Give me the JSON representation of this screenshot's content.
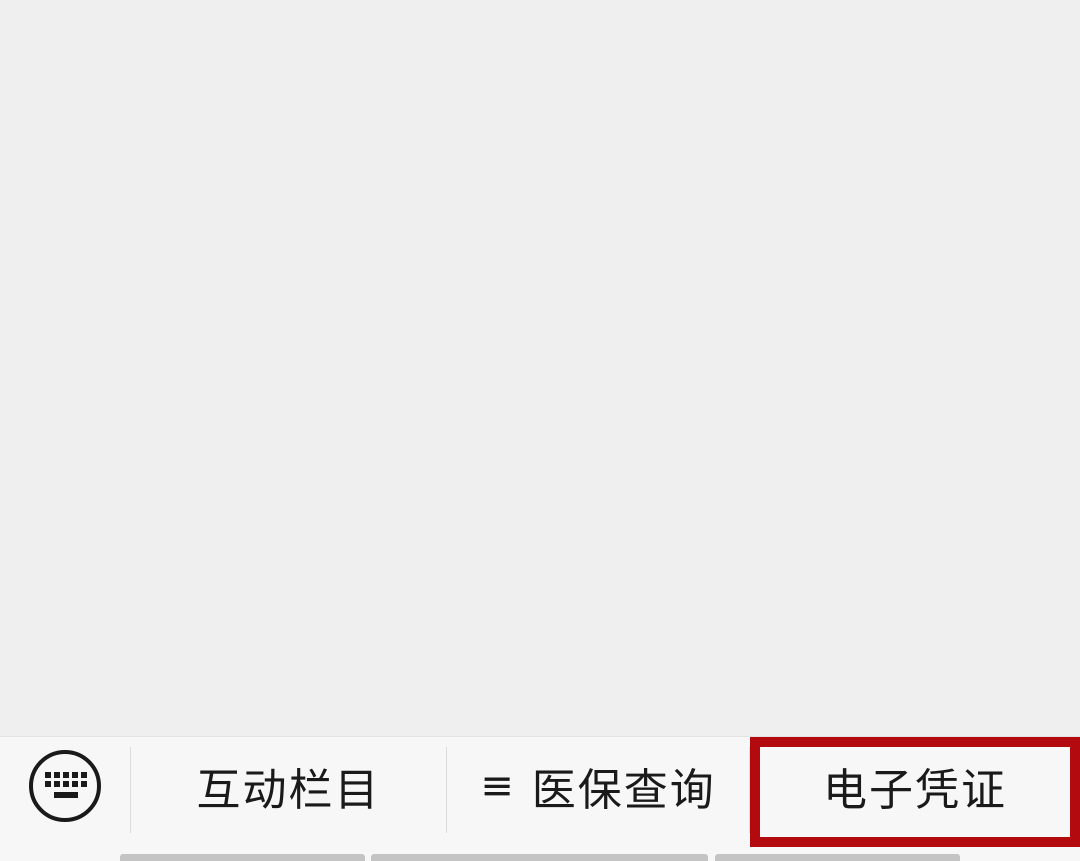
{
  "menu_bar": {
    "keyboard_icon": "keyboard-icon",
    "items": [
      {
        "label": "互动栏目",
        "has_submenu_icon": false
      },
      {
        "label": "医保查询",
        "has_submenu_icon": true,
        "submenu_icon": "≡"
      },
      {
        "label": "电子凭证",
        "has_submenu_icon": false
      }
    ]
  },
  "colors": {
    "background": "#efefef",
    "menu_bar": "#f7f7f7",
    "text": "#1a1a1a",
    "highlight": "#b20a0e",
    "indicator": "#c4c4c4"
  }
}
